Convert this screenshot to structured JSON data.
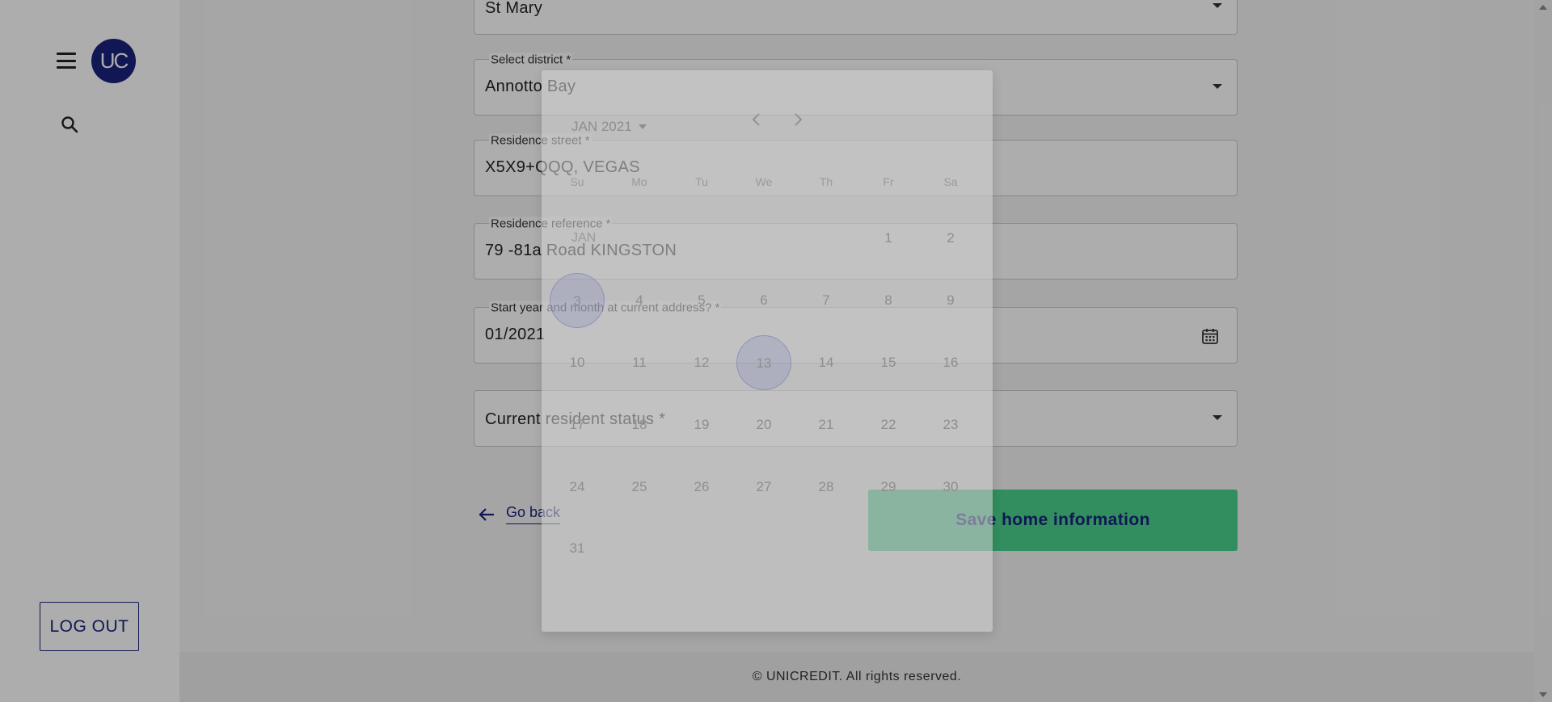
{
  "sidebar": {
    "avatar_initials": "UC",
    "logout_label": "LOG OUT"
  },
  "form": {
    "parish": {
      "value": "St Mary"
    },
    "district": {
      "label": "Select district *",
      "value": "Annotto Bay"
    },
    "street": {
      "label": "Residence street *",
      "value": "X5X9+QQQ, VEGAS"
    },
    "reference": {
      "label": "Residence reference *",
      "value": "79 -81a Road KINGSTON"
    },
    "start": {
      "label": "Start year and month at current address? *",
      "value": "01/2021"
    },
    "status": {
      "placeholder": "Current resident status *"
    }
  },
  "actions": {
    "go_back": "Go back",
    "save": "Save home information"
  },
  "footer": {
    "text": "© UNICREDIT. All rights reserved."
  },
  "datepicker": {
    "header": "JAN 2021",
    "month_tag": "JAN",
    "weekdays": [
      "Su",
      "Mo",
      "Tu",
      "We",
      "Th",
      "Fr",
      "Sa"
    ],
    "days": [
      "1",
      "2",
      "3",
      "4",
      "5",
      "6",
      "7",
      "8",
      "9",
      "10",
      "11",
      "12",
      "13",
      "14",
      "15",
      "16",
      "17",
      "18",
      "19",
      "20",
      "21",
      "22",
      "23",
      "24",
      "25",
      "26",
      "27",
      "28",
      "29",
      "30",
      "31"
    ],
    "highlighted_day": "3",
    "selected_day": "13"
  },
  "colors": {
    "brand": "#1a237e",
    "accent": "#4bd18c"
  }
}
